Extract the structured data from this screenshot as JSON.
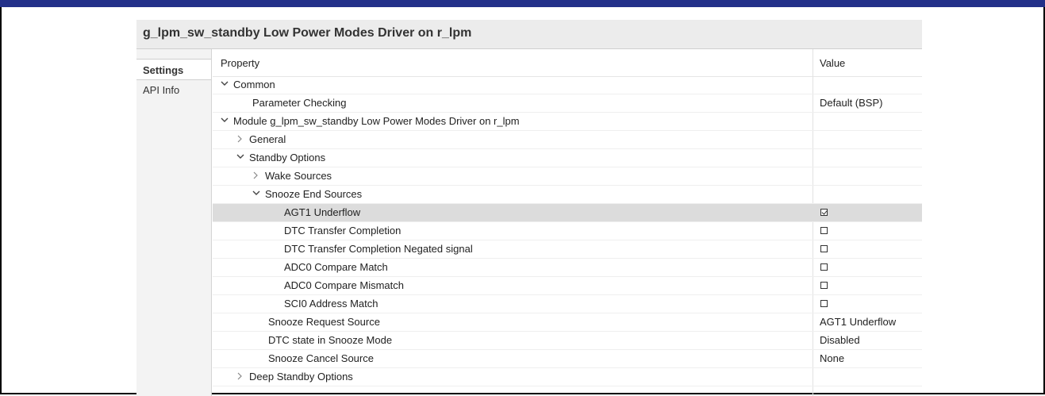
{
  "panel": {
    "title": "g_lpm_sw_standby Low Power Modes Driver on r_lpm"
  },
  "tabs": [
    {
      "label": "Settings",
      "active": true
    },
    {
      "label": "API Info",
      "active": false
    }
  ],
  "table": {
    "header_property": "Property",
    "header_value": "Value",
    "rows": [
      {
        "label": "Common",
        "expander": "expanded",
        "value": ""
      },
      {
        "label": "Parameter Checking",
        "expander": "none",
        "value": "Default (BSP)"
      },
      {
        "label": "Module g_lpm_sw_standby Low Power Modes Driver on r_lpm",
        "expander": "expanded",
        "value": ""
      },
      {
        "label": "General",
        "expander": "collapsed",
        "value": ""
      },
      {
        "label": "Standby Options",
        "expander": "expanded",
        "value": ""
      },
      {
        "label": "Wake Sources",
        "expander": "collapsed",
        "value": ""
      },
      {
        "label": "Snooze End Sources",
        "expander": "expanded",
        "value": ""
      },
      {
        "label": "AGT1 Underflow",
        "expander": "none",
        "value": "",
        "checkbox": true,
        "checked": true,
        "selected": true
      },
      {
        "label": "DTC Transfer Completion",
        "expander": "none",
        "value": "",
        "checkbox": true,
        "checked": false
      },
      {
        "label": "DTC Transfer Completion Negated signal",
        "expander": "none",
        "value": "",
        "checkbox": true,
        "checked": false
      },
      {
        "label": "ADC0 Compare Match",
        "expander": "none",
        "value": "",
        "checkbox": true,
        "checked": false
      },
      {
        "label": "ADC0 Compare Mismatch",
        "expander": "none",
        "value": "",
        "checkbox": true,
        "checked": false
      },
      {
        "label": "SCI0 Address Match",
        "expander": "none",
        "value": "",
        "checkbox": true,
        "checked": false
      },
      {
        "label": "Snooze Request Source",
        "expander": "none",
        "value": "AGT1 Underflow"
      },
      {
        "label": "DTC state in Snooze Mode",
        "expander": "none",
        "value": "Disabled"
      },
      {
        "label": "Snooze Cancel Source",
        "expander": "none",
        "value": "None"
      },
      {
        "label": "Deep Standby Options",
        "expander": "collapsed",
        "value": ""
      }
    ]
  },
  "colors": {
    "top_bar": "#233089",
    "selected_row": "#dcdcdc"
  }
}
